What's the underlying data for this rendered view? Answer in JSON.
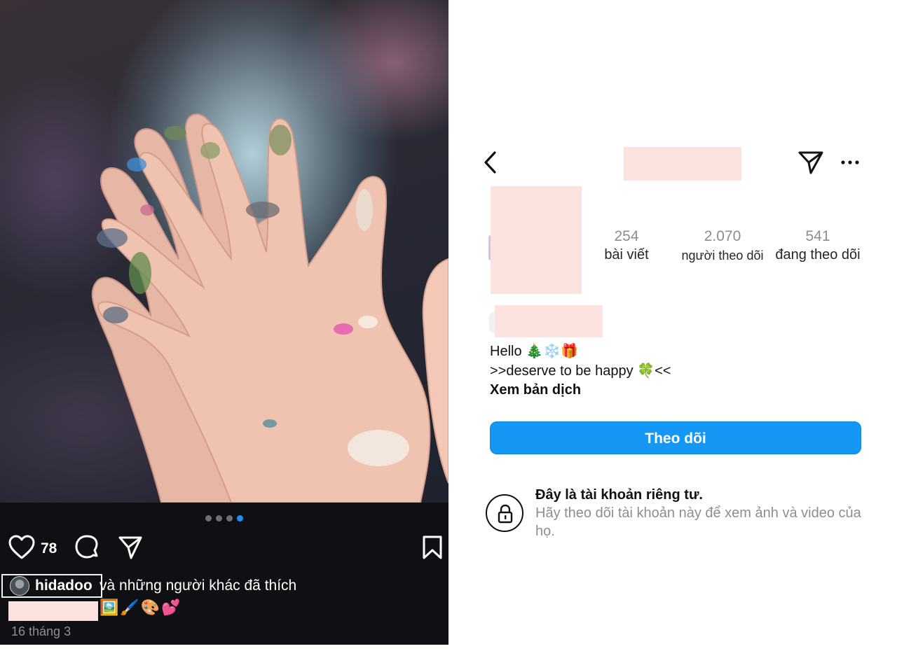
{
  "post": {
    "image_description_icon": "painted-hands-photo",
    "carousel": {
      "count": 4,
      "active_index": 3
    },
    "like_count": "78",
    "liked_by": {
      "username": "hidadoo",
      "rest": "và những người khác đã thích"
    },
    "caption_emojis": "🖼️🖌️🎨💕",
    "date": "16 tháng 3",
    "icons": [
      "heart-icon",
      "comment-icon",
      "share-icon",
      "bookmark-icon"
    ]
  },
  "profile": {
    "header_icons": [
      "back-arrow-icon",
      "send-icon",
      "more-icon"
    ],
    "stats": {
      "posts": {
        "value": "254",
        "label": "bài viết"
      },
      "followers": {
        "value": "2.070",
        "label": "người theo dõi"
      },
      "following": {
        "value": "541",
        "label": "đang theo dõi"
      }
    },
    "bio": {
      "line1_text": "Hello ",
      "line1_emoji": "🎄❄️🎁",
      "line2_text_a": ">>deserve to be happy ",
      "line2_emoji": "🍀",
      "line2_text_b": "<<",
      "see_translation": "Xem bản dịch"
    },
    "follow_button": "Theo dõi",
    "private": {
      "title": "Đây là tài khoản riêng tư.",
      "description": "Hãy theo dõi tài khoản này để xem ảnh và video của họ."
    },
    "colors": {
      "follow_blue": "#1497f5",
      "redaction_pink": "#fde3e0",
      "carousel_active": "#1d8ff2"
    }
  }
}
